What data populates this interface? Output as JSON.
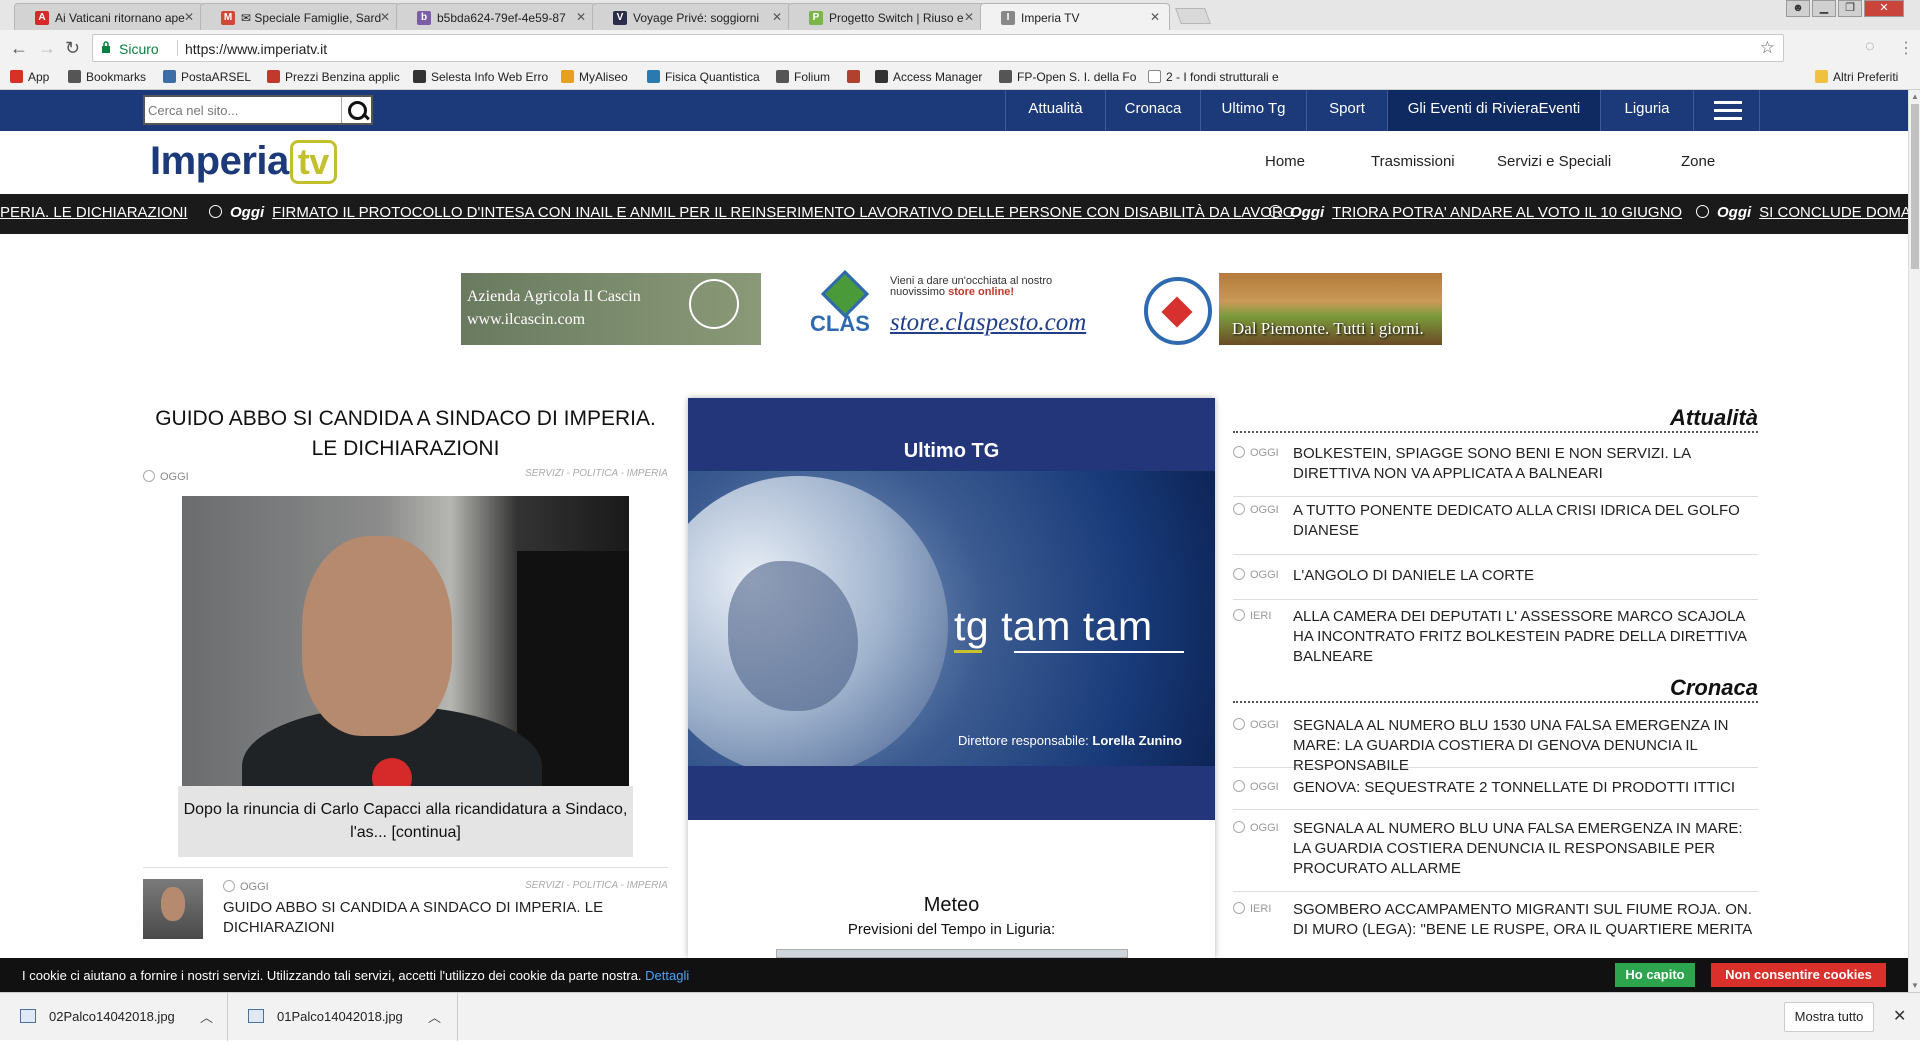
{
  "browser": {
    "tabs": [
      {
        "title": "Ai Vaticani ritornano ape",
        "fav_color": "#d62a2a",
        "fav_letter": "A"
      },
      {
        "title": "✉ Speciale Famiglie, Sard",
        "fav_color": "#d14836",
        "fav_letter": "M"
      },
      {
        "title": "b5bda624-79ef-4e59-87",
        "fav_color": "#7b5ea7",
        "fav_letter": "b"
      },
      {
        "title": "Voyage Privé: soggiorni",
        "fav_color": "#2b2b4a",
        "fav_letter": "V"
      },
      {
        "title": "Progetto Switch | Riuso e",
        "fav_color": "#7ab648",
        "fav_letter": "P"
      },
      {
        "title": "Imperia TV",
        "fav_color": "#888888",
        "fav_letter": "I"
      }
    ],
    "address": {
      "secure_label": "Sicuro",
      "url": "https://www.imperiatv.it"
    },
    "bookmarks": [
      {
        "label": "App",
        "color": "#d93025"
      },
      {
        "label": "Bookmarks",
        "color": "#555555"
      },
      {
        "label": "PostaARSEL",
        "color": "#3a6ea5"
      },
      {
        "label": "Prezzi Benzina applic",
        "color": "#c0392b"
      },
      {
        "label": "Selesta Info Web Erro",
        "color": "#333333"
      },
      {
        "label": "MyAliseo",
        "color": "#e6a020"
      },
      {
        "label": "Fisica Quantistica",
        "color": "#2a7ab0"
      },
      {
        "label": "Folium",
        "color": "#555555"
      },
      {
        "label": "",
        "color": "#b04030"
      },
      {
        "label": "Access Manager",
        "color": "#333333"
      },
      {
        "label": "FP-Open S. I. della Fo",
        "color": "#555555"
      },
      {
        "label": "2 - I fondi strutturali e",
        "color": "#888888"
      }
    ],
    "other_bookmarks": "Altri Preferiti"
  },
  "site": {
    "search_placeholder": "Cerca nel sito...",
    "topnav": [
      "Attualità",
      "Cronaca",
      "Ultimo Tg",
      "Sport",
      "Gli Eventi di RivieraEventi",
      "Liguria"
    ],
    "logo_text": "Imperia",
    "logo_tv": "tv",
    "menu": [
      "Home",
      "Trasmissioni",
      "Servizi e Speciali",
      "Zone"
    ],
    "ticker": [
      {
        "oggi": "",
        "text": "PERIA. LE DICHIARAZIONI"
      },
      {
        "oggi": "Oggi",
        "text": "FIRMATO IL PROTOCOLLO D'INTESA CON INAIL E ANMIL PER IL REINSERIMENTO LAVORATIVO DELLE PERSONE CON DISABILITÀ DA LAVORO"
      },
      {
        "oggi": "Oggi",
        "text": "TRIORA POTRA' ANDARE AL VOTO IL 10 GIUGNO"
      },
      {
        "oggi": "Oggi",
        "text": "SI CONCLUDE DOMA"
      }
    ],
    "banners": {
      "b1_line1": "Azienda Agricola Il Cascin",
      "b1_line2": "www.ilcascin.com",
      "b2_clas": "CLAS",
      "b2_line1": "Vieni a dare un'occhiata al nostro",
      "b2_line2a": "nuovissimo ",
      "b2_line2b": "store online!",
      "b2_url": "store.claspesto.com",
      "b3_slogan": "Dal Piemonte. Tutti i giorni."
    },
    "lead": {
      "title": "GUIDO ABBO SI CANDIDA A SINDACO DI IMPERIA. LE DICHIARAZIONI",
      "date": "OGGI",
      "category": "SERVIZI - POLITICA - IMPERIA",
      "caption": "Dopo la rinuncia di Carlo Capacci alla ricandidatura a Sindaco, l'as... [continua]"
    },
    "small_article": {
      "date": "OGGI",
      "category": "SERVIZI - POLITICA - IMPERIA",
      "title": "GUIDO ABBO SI CANDIDA A SINDACO DI IMPERIA. LE DICHIARAZIONI"
    },
    "tg": {
      "title": "Ultimo TG",
      "brand_tg": "tg",
      "brand_name": "tam tam",
      "credit_label": "Direttore responsabile: ",
      "credit_name": "Lorella Zunino",
      "meteo_title": "Meteo",
      "meteo_sub": "Previsioni del Tempo in Liguria:"
    },
    "sections": [
      {
        "title": "Attualità",
        "items": [
          {
            "date": "OGGI",
            "text": "BOLKESTEIN, SPIAGGE SONO BENI E NON SERVIZI. LA DIRETTIVA NON VA APPLICATA A BALNEARI"
          },
          {
            "date": "OGGI",
            "text": "A TUTTO PONENTE DEDICATO ALLA CRISI IDRICA DEL GOLFO DIANESE"
          },
          {
            "date": "OGGI",
            "text": "L'ANGOLO DI DANIELE LA CORTE"
          },
          {
            "date": "IERI",
            "text": "ALLA CAMERA DEI DEPUTATI L' ASSESSORE MARCO SCAJOLA HA INCONTRATO FRITZ BOLKESTEIN PADRE DELLA DIRETTIVA BALNEARE"
          }
        ]
      },
      {
        "title": "Cronaca",
        "items": [
          {
            "date": "OGGI",
            "text": "SEGNALA AL NUMERO BLU 1530 UNA FALSA EMERGENZA IN MARE: LA GUARDIA COSTIERA DI GENOVA DENUNCIA IL RESPONSABILE"
          },
          {
            "date": "OGGI",
            "text": "GENOVA: SEQUESTRATE 2 TONNELLATE DI PRODOTTI ITTICI"
          },
          {
            "date": "OGGI",
            "text": "SEGNALA AL NUMERO BLU UNA FALSA EMERGENZA IN MARE: LA GUARDIA COSTIERA DENUNCIA IL RESPONSABILE PER PROCURATO ALLARME"
          },
          {
            "date": "IERI",
            "text": "SGOMBERO ACCAMPAMENTO MIGRANTI SUL FIUME ROJA. ON. DI MURO (LEGA): \"BENE LE RUSPE, ORA IL QUARTIERE MERITA"
          }
        ]
      }
    ],
    "cookie": {
      "message": "I cookie ci aiutano a fornire i nostri servizi. Utilizzando tali servizi, accetti l'utilizzo dei cookie da parte nostra.",
      "link": "Dettagli",
      "accept": "Ho capito",
      "reject": "Non consentire cookies"
    }
  },
  "downloads": {
    "files": [
      "02Palco14042018.jpg",
      "01Palco14042018.jpg"
    ],
    "show_all": "Mostra tutto"
  }
}
